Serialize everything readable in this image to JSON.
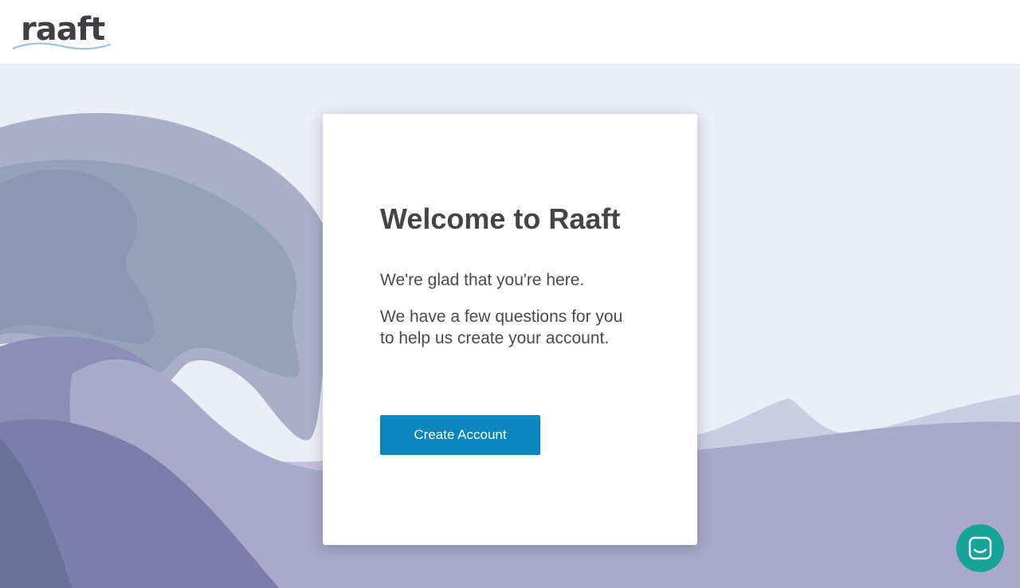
{
  "brand": {
    "name": "raaft",
    "text_color": "#404044",
    "wave_color": "#9ec3dd"
  },
  "welcome": {
    "title": "Welcome to Raaft",
    "line1": "We're glad that you're here.",
    "line2": "We have a few questions for you to help us create your account."
  },
  "actions": {
    "create_account_label": "Create Account"
  },
  "chat": {
    "icon": "chat-bubble-icon",
    "color": "#16a39a"
  },
  "colors": {
    "button": "#0a86bd",
    "background": "#ebeef6"
  }
}
